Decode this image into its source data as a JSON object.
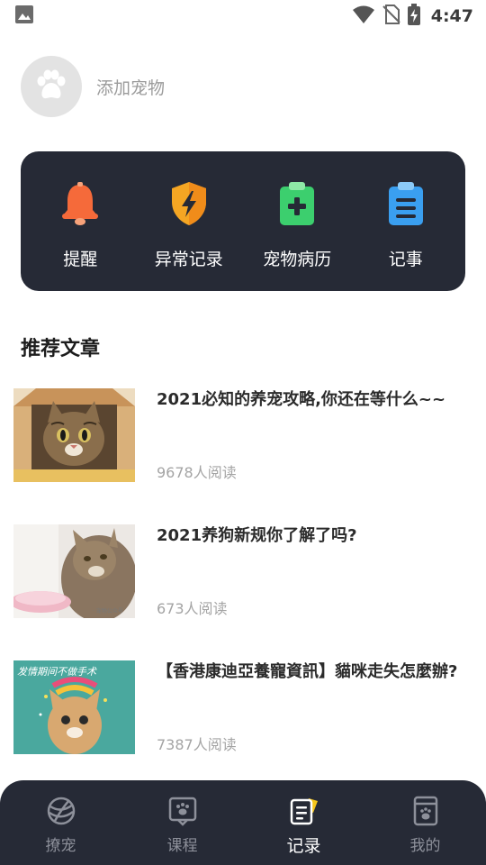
{
  "status_bar": {
    "time": "4:47"
  },
  "profile": {
    "add_pet_label": "添加宠物"
  },
  "quick_actions": [
    {
      "label": "提醒",
      "icon": "bell-icon"
    },
    {
      "label": "异常记录",
      "icon": "lightning-shield-icon"
    },
    {
      "label": "宠物病历",
      "icon": "medical-clipboard-icon"
    },
    {
      "label": "记事",
      "icon": "notes-clipboard-icon"
    }
  ],
  "section": {
    "title": "推荐文章"
  },
  "articles": [
    {
      "title": "2021必知的养宠攻略,你还在等什么~~",
      "reads": "9678人阅读"
    },
    {
      "title": "2021养狗新规你了解了吗?",
      "reads": "673人阅读"
    },
    {
      "title": "【香港康迪亞養寵資訊】貓咪走失怎麼辦?",
      "reads": "7387人阅读",
      "thumb_text": "发情期间不做手术"
    }
  ],
  "bottom_nav": [
    {
      "label": "撩宠",
      "icon": "yarn-ball-icon",
      "active": false
    },
    {
      "label": "课程",
      "icon": "paw-screen-icon",
      "active": false
    },
    {
      "label": "记录",
      "icon": "record-notes-icon",
      "active": true
    },
    {
      "label": "我的",
      "icon": "paw-card-icon",
      "active": false
    }
  ],
  "colors": {
    "panel_bg": "#262a36",
    "bell": "#f56a3a",
    "shield": "#f5a623",
    "medical": "#3ccf6e",
    "notes": "#3a9ff0",
    "active_accent": "#f5c518"
  }
}
